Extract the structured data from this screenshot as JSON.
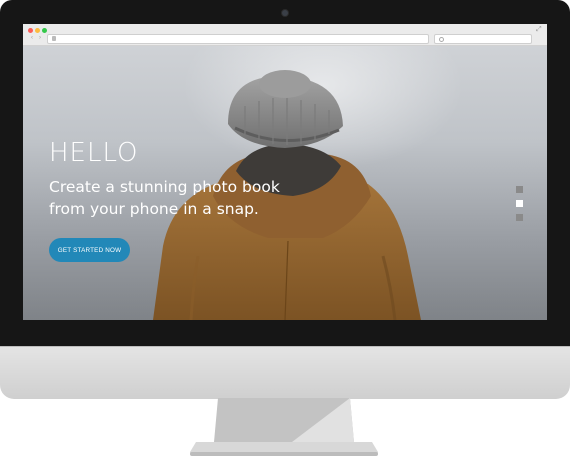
{
  "browser": {
    "back_glyph": "‹",
    "forward_glyph": "›",
    "expand_glyph": "⤢",
    "icons": [
      "close-dot",
      "minimize-dot",
      "zoom-dot",
      "lock-icon",
      "search-icon",
      "fullscreen-icon"
    ]
  },
  "hero": {
    "title": "HELLO",
    "subtitle": "Create a stunning photo book from your phone in a snap.",
    "cta_label": "GET STARTED NOW",
    "slides_total": 3,
    "active_slide": 2
  },
  "colors": {
    "cta": "#2288b8",
    "bezel": "#161616",
    "jacket": "#9a6a34",
    "beanie": "#8e8e8e"
  }
}
